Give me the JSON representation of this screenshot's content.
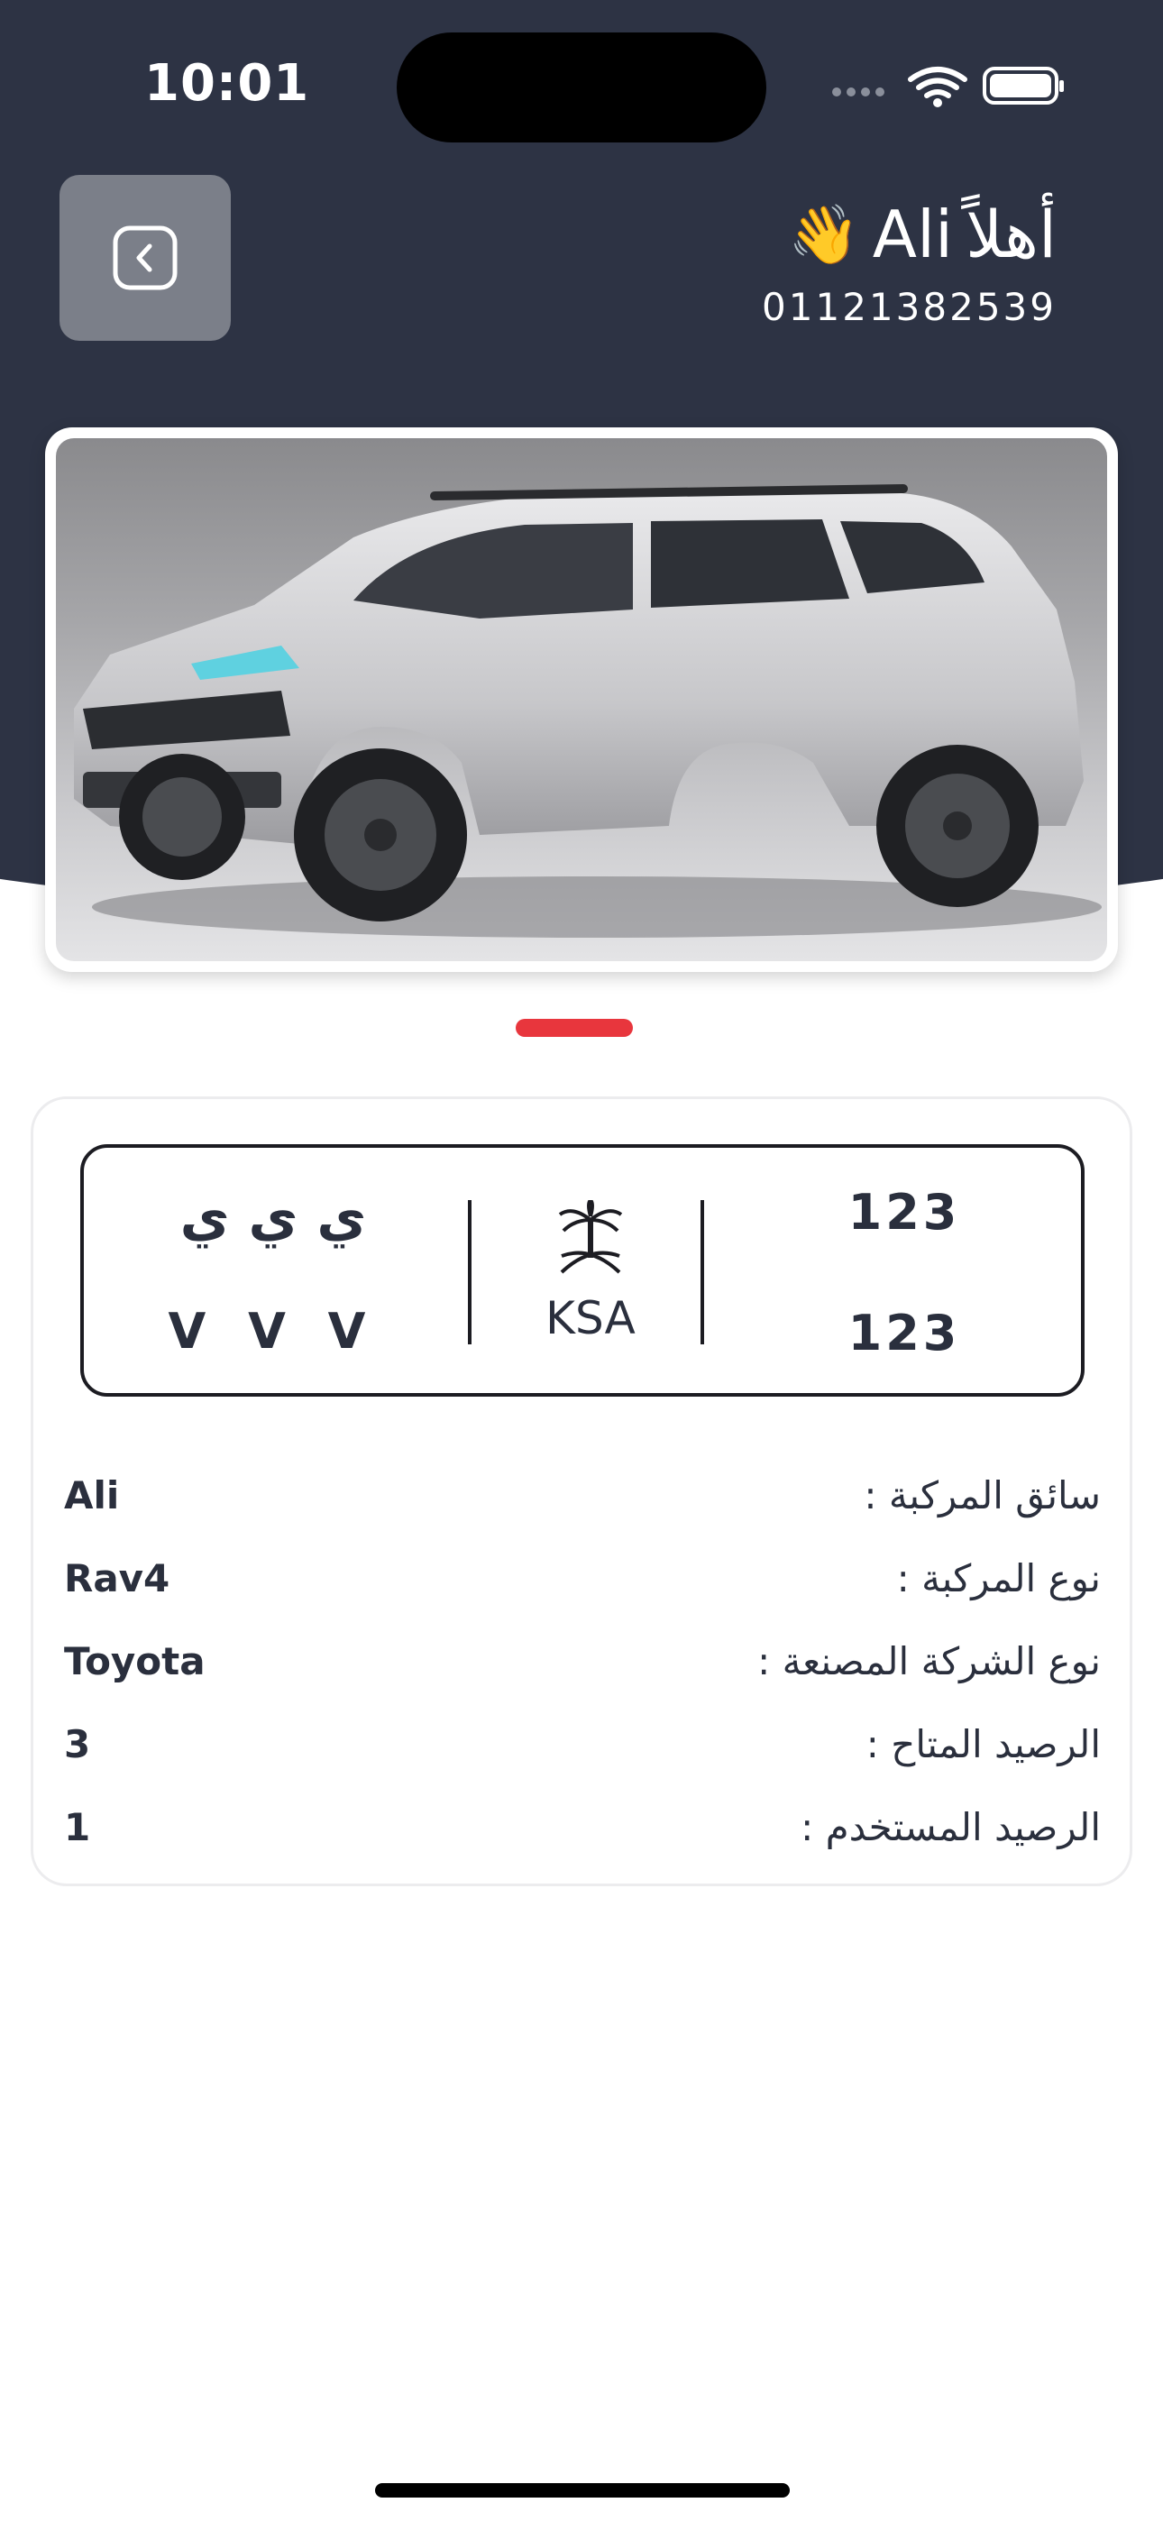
{
  "status_bar": {
    "time": "10:01"
  },
  "header": {
    "greeting_name": "Ali",
    "greeting_word": "أهلاً",
    "greeting_emoji": "👋",
    "phone": "01121382539",
    "back_icon": "chevron-left-icon"
  },
  "plate": {
    "letters_arabic": "ي ي ي",
    "letters_latin": "V V V",
    "country": "KSA",
    "number_top": "123",
    "number_bottom": "123",
    "emblem": "saudi-emblem-icon"
  },
  "details": [
    {
      "label": "سائق المركبة :",
      "value": "Ali"
    },
    {
      "label": "نوع المركبة :",
      "value": "Rav4"
    },
    {
      "label": "نوع الشركة المصنعة :",
      "value": "Toyota"
    },
    {
      "label": "الرصيد المتاح :",
      "value": "3"
    },
    {
      "label": "الرصيد المستخدم :",
      "value": "1"
    }
  ],
  "colors": {
    "header_bg": "#2d3344",
    "accent": "#e8363d",
    "text": "#2a2f3d"
  }
}
